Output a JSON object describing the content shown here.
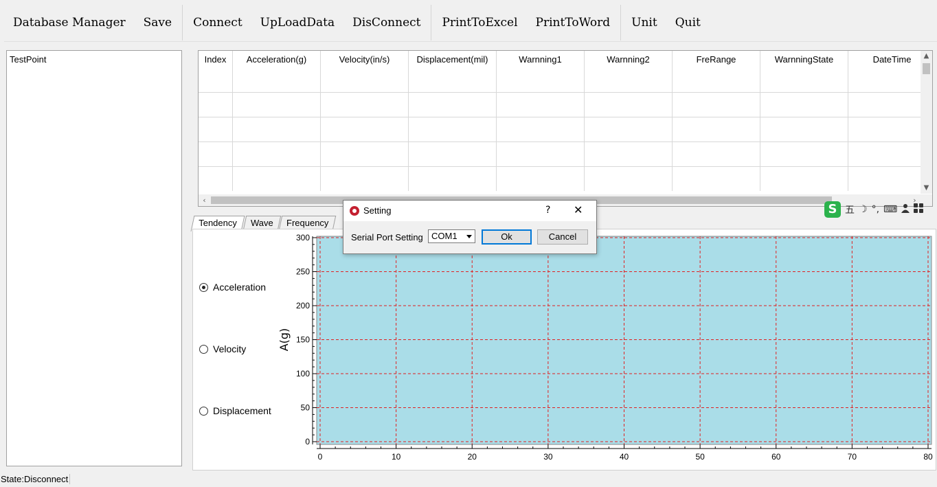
{
  "toolbar": {
    "database_manager": "Database Manager",
    "save": "Save",
    "connect": "Connect",
    "upload_data": "UpLoadData",
    "disconnect": "DisConnect",
    "print_excel": "PrintToExcel",
    "print_word": "PrintToWord",
    "unit": "Unit",
    "quit": "Quit"
  },
  "tree": {
    "root": "TestPoint"
  },
  "grid": {
    "columns": [
      "Index",
      "Acceleration(g)",
      "Velocity(in/s)",
      "Displacement(mil)",
      "Warnning1",
      "Warnning2",
      "FreRange",
      "WarnningState",
      "DateTime"
    ]
  },
  "tabs": [
    "Tendency",
    "Wave",
    "Frequency"
  ],
  "radios": {
    "acceleration": "Acceleration",
    "velocity": "Velocity",
    "displacement": "Displacement",
    "selected": "acceleration"
  },
  "chart_data": {
    "type": "line",
    "ylabel": "A(g)",
    "xlim": [
      0,
      80
    ],
    "ylim": [
      0,
      300
    ],
    "x_ticks": [
      "0",
      "10",
      "20",
      "30",
      "40",
      "50",
      "60",
      "70",
      "80"
    ],
    "y_ticks": [
      "0",
      "50",
      "100",
      "150",
      "200",
      "250",
      "300"
    ],
    "series": [],
    "grid": true,
    "plot_background": "#aadde8",
    "grid_color": "#e02020"
  },
  "dialog": {
    "title": "Setting",
    "help": "?",
    "close": "✕",
    "label": "Serial Port Setting",
    "port_value": "COM1",
    "ok": "Ok",
    "cancel": "Cancel"
  },
  "ime": {
    "logo": "S",
    "mode": "五",
    "moon": "☽",
    "punct": "°,",
    "keyboard": "⌨",
    "user": "👤",
    "apps": "▦"
  },
  "status": "State:Disconnect"
}
